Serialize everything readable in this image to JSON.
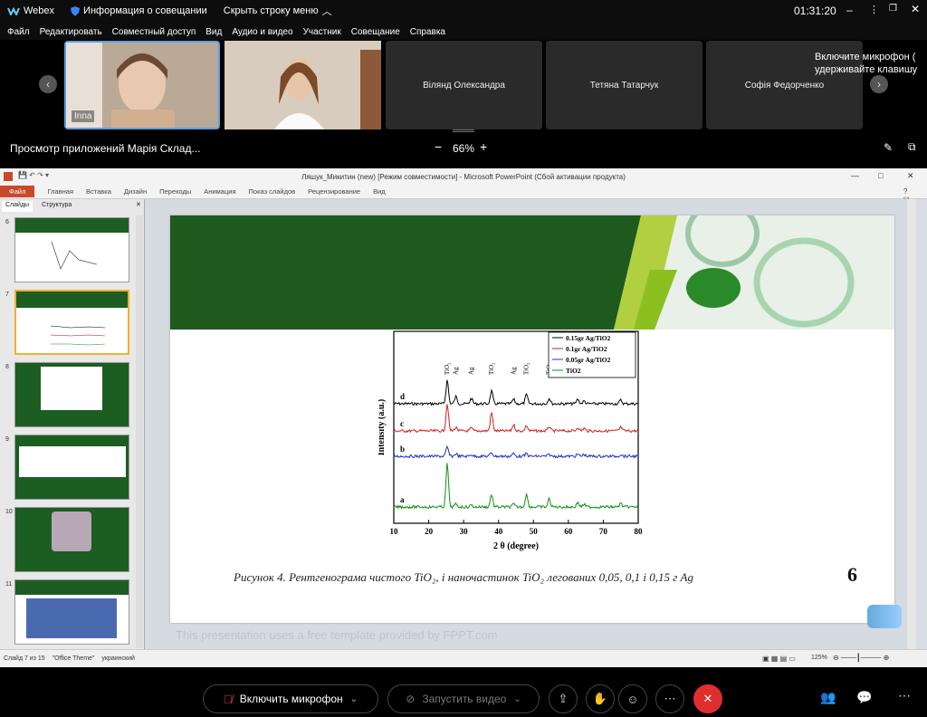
{
  "app": {
    "name": "Webex",
    "meeting_info": "Информация о совещании",
    "hide_menu": "Скрыть строку меню",
    "time": "01:31:20"
  },
  "menu": [
    "Файл",
    "Редактировать",
    "Совместный доступ",
    "Вид",
    "Аудио и видео",
    "Участник",
    "Совещание",
    "Справка"
  ],
  "participants": {
    "self_name": "Inna",
    "tiles": [
      "Вілянд Олександра",
      "Тетяна Татарчук",
      "Софія Федорченко"
    ],
    "notice_line1": "Включите микрофон (",
    "notice_line2": "удерживайте клавишу"
  },
  "share": {
    "viewing": "Просмотр приложений Марія Склад...",
    "zoom": "66%",
    "minus": "−",
    "plus": "+"
  },
  "ppt": {
    "title": "Ляшук_Микитин (new) [Режим совместимости] - Microsoft PowerPoint (Сбой активации продукта)",
    "ribbon": [
      "Файл",
      "Главная",
      "Вставка",
      "Дизайн",
      "Переходы",
      "Анимация",
      "Показ слайдов",
      "Рецензирование",
      "Вид"
    ],
    "pane_tabs": [
      "Слайды",
      "Структура"
    ],
    "slide_numbers": [
      "6",
      "7",
      "8",
      "9",
      "10",
      "11"
    ],
    "status": [
      "Слайд 7 из 15",
      "\"Office Theme\"",
      "украинский"
    ],
    "zoom": "125%",
    "watermark": "This presentation uses a free template provided by FPPT.com",
    "slide_number_big": "6",
    "caption": "Рисунок 4. Рентгенограма чистого TiO₂, і наночастинок TiO₂ легованих 0,05, 0,1 і 0,15 г Ag"
  },
  "chart_data": {
    "type": "line",
    "xlabel": "2 θ (degree)",
    "ylabel": "Intensity (a.u.)",
    "xlim": [
      10,
      80
    ],
    "xticks": [
      10,
      20,
      30,
      40,
      50,
      60,
      70,
      80
    ],
    "legend": [
      "0.15gr Ag/TiO2",
      "0.1gr Ag/TiO2",
      "0.05gr Ag/TiO2",
      "TiO2"
    ],
    "legend_placement": "top-right",
    "series": [
      {
        "name": "0.15gr Ag/TiO2",
        "label": "d",
        "color": "#000000"
      },
      {
        "name": "0.1gr Ag/TiO2",
        "label": "c",
        "color": "#d02020"
      },
      {
        "name": "0.05gr Ag/TiO2",
        "label": "b",
        "color": "#2030c0"
      },
      {
        "name": "TiO2",
        "label": "a",
        "color": "#109010"
      }
    ],
    "peaks": [
      {
        "x": 25.3,
        "label": "TiO₂"
      },
      {
        "x": 27.8,
        "label": "Ag"
      },
      {
        "x": 32.2,
        "label": "Ag"
      },
      {
        "x": 38.0,
        "label": "TiO₂"
      },
      {
        "x": 44.3,
        "label": "Ag"
      },
      {
        "x": 48.0,
        "label": "TiO₂"
      },
      {
        "x": 54.5,
        "label": "TiO₂"
      },
      {
        "x": 62.7,
        "label": "TiO₂"
      },
      {
        "x": 64.5,
        "label": "Ag"
      },
      {
        "x": 75.0,
        "label": "TiO₂"
      }
    ]
  },
  "controls": {
    "mic": "Включить микрофон",
    "video": "Запустить видео"
  }
}
